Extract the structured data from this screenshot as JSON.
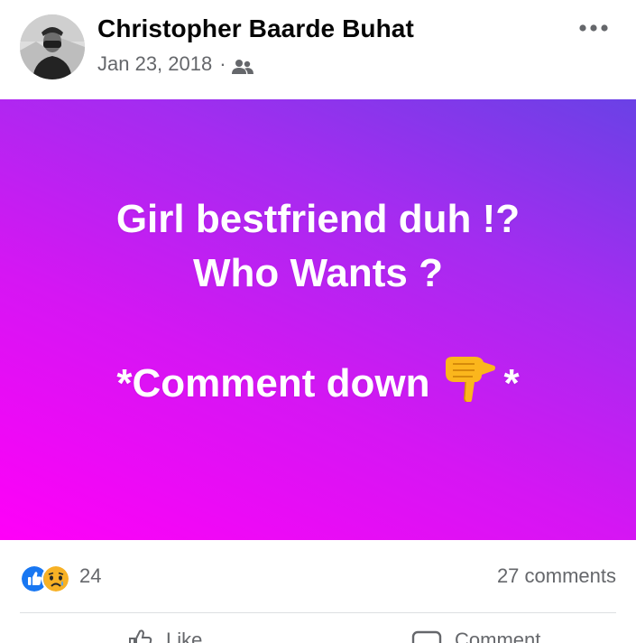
{
  "post": {
    "author": {
      "name": "Christopher Baarde Buhat",
      "avatar_icon": "user-avatar-photo"
    },
    "meta": {
      "date": "Jan 23, 2018",
      "separator": "·",
      "audience_icon": "friends-icon"
    },
    "more_icon": "more-horizontal-icon",
    "body": {
      "line1": "Girl bestfriend duh !?",
      "line2": "Who Wants ?",
      "line3_prefix": "*Comment down",
      "line3_emoji": "backhand-index-pointing-down",
      "line3_suffix": "*",
      "background_colors": [
        "#6a41e6",
        "#ff00f8"
      ]
    },
    "reactions": {
      "icons": [
        "like-reaction-icon",
        "sad-reaction-icon"
      ],
      "count": "24",
      "comments": "27 comments",
      "like_color": "#1877f2"
    },
    "actions": {
      "like_label": "Like",
      "comment_label": "Comment"
    }
  }
}
